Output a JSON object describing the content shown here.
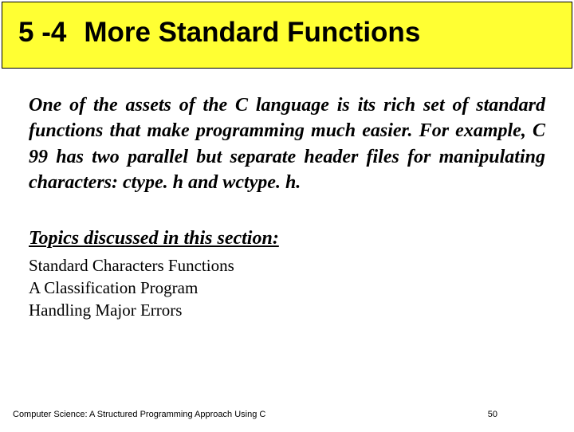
{
  "header": {
    "section_number": "5 -4",
    "section_title": "More Standard Functions"
  },
  "intro": "One of the assets of the C language is its rich set of standard functions that make programming much easier. For example, C 99 has two parallel but separate header files for manipulating characters: ctype. h and wctype. h.",
  "topics_heading": "Topics discussed in this section:",
  "topics": [
    "Standard Characters Functions",
    "A Classification Program",
    "Handling Major Errors"
  ],
  "footer": {
    "book_title": "Computer Science: A Structured Programming Approach Using C",
    "page_number": "50"
  }
}
